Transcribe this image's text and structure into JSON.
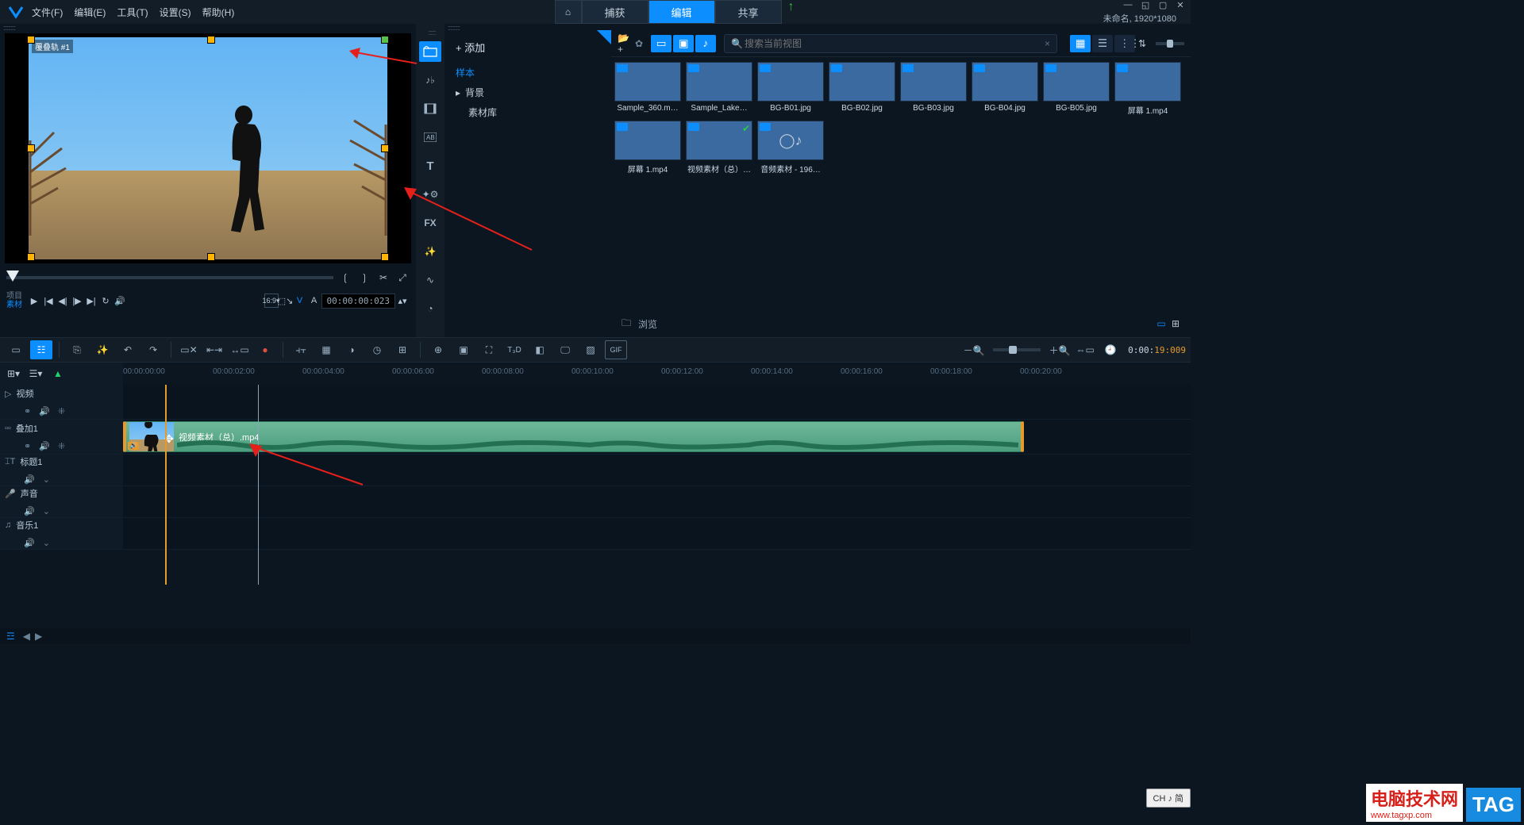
{
  "menu": {
    "file": "文件(F)",
    "edit": "编辑(E)",
    "tools": "工具(T)",
    "settings": "设置(S)",
    "help": "帮助(H)"
  },
  "tabs": {
    "home": "⌂",
    "capture": "捕获",
    "edit": "编辑",
    "share": "共享"
  },
  "project_info": "未命名, 1920*1080",
  "preview": {
    "clip_label": "覆叠轨 #1",
    "pm_project": "项目",
    "pm_material": "素材",
    "timecode": "00:00:00:023",
    "tc_suffix": "✦"
  },
  "add_label": "+  添加",
  "tree": {
    "sample": "样本",
    "background": "背景",
    "library": "素材库"
  },
  "search_placeholder": "搜索当前视图",
  "thumbs": [
    {
      "name": "Sample_360.m…",
      "cls": "gradA"
    },
    {
      "name": "Sample_Lake…",
      "cls": "gradA"
    },
    {
      "name": "BG-B01.jpg",
      "cls": "gradB"
    },
    {
      "name": "BG-B02.jpg",
      "cls": "gradB"
    },
    {
      "name": "BG-B03.jpg",
      "cls": "gradB"
    },
    {
      "name": "BG-B04.jpg",
      "cls": "gradC"
    },
    {
      "name": "BG-B05.jpg",
      "cls": "gradD"
    },
    {
      "name": "屏幕 1.mp4",
      "cls": "gradE"
    },
    {
      "name": "屏幕 1.mp4",
      "cls": "gradE"
    },
    {
      "name": "视频素材（总）…",
      "cls": "gradA"
    },
    {
      "name": "音频素材 - 196…",
      "cls": "gradF"
    }
  ],
  "browse": "浏览",
  "ruler": [
    "00:00:00:00",
    "00:00:02:00",
    "00:00:04:00",
    "00:00:06:00",
    "00:00:08:00",
    "00:00:10:00",
    "00:00:12:00",
    "00:00:14:00",
    "00:00:16:00",
    "00:00:18:00",
    "00:00:20:00"
  ],
  "tracks": {
    "video": "视频",
    "overlay": "叠加1",
    "title": "标题1",
    "voice": "声音",
    "music": "音乐1"
  },
  "clip_name": "视频素材（总）.mp4",
  "tl_timecode_pre": "0:00:",
  "tl_timecode_post": "19:009",
  "ime": "CH ♪ 简",
  "wm_text": "电脑技术网",
  "wm_url": "www.tagxp.com",
  "wm_tag": "TAG"
}
